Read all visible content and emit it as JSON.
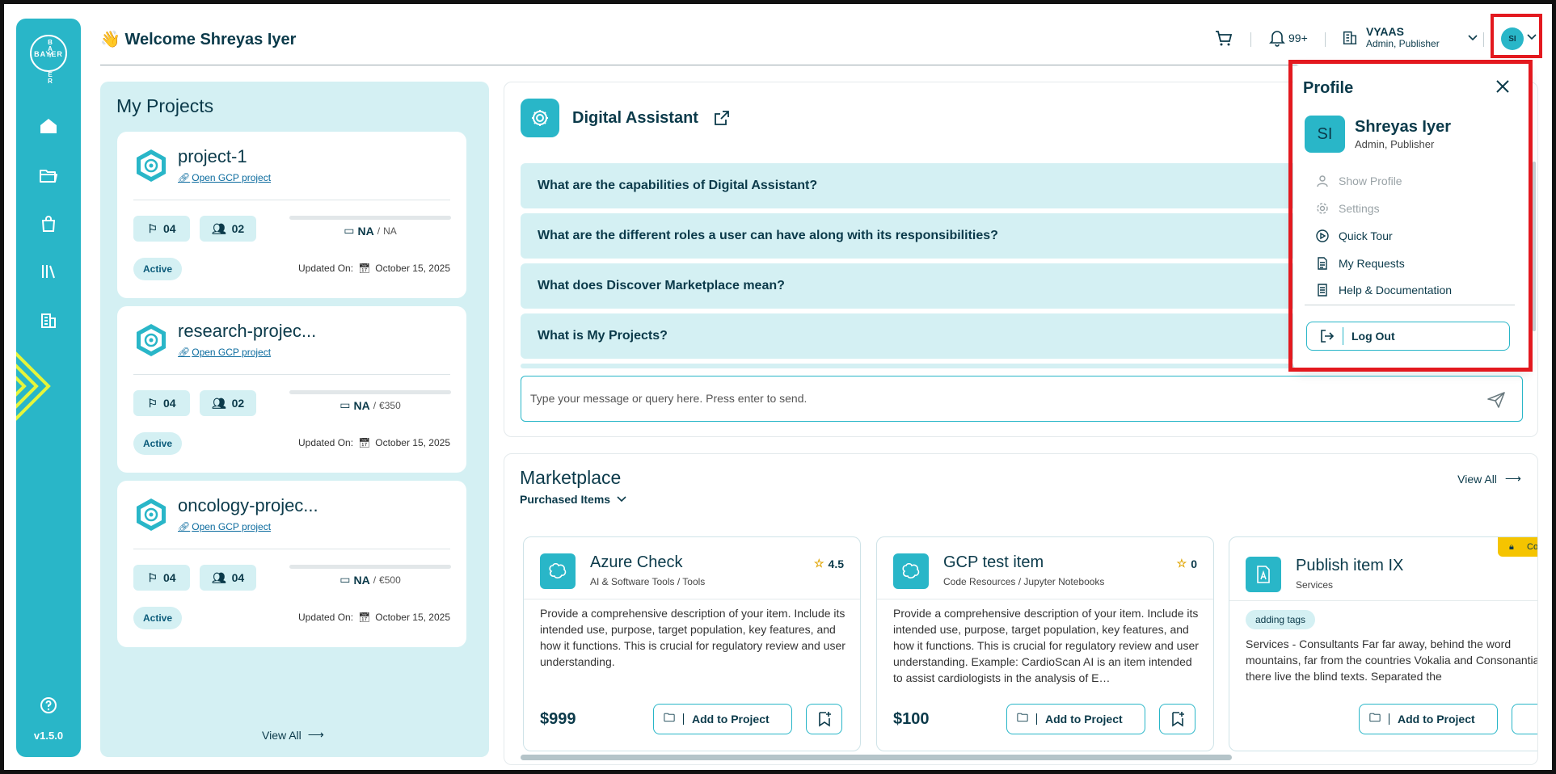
{
  "app": {
    "version": "v1.5.0",
    "logo_text": "BAYER"
  },
  "header": {
    "welcome": "👋 Welcome Shreyas Iyer",
    "notifications": "99+",
    "org_name": "VYAAS",
    "org_role": "Admin, Publisher",
    "avatar_initials": "SI"
  },
  "projects": {
    "title": "My Projects",
    "view_all": "View All",
    "updated_label": "Updated On:",
    "items": [
      {
        "name": "project-1",
        "link": "Open GCP project",
        "flags": "04",
        "members": "02",
        "budget": "NA",
        "budget_of": "NA",
        "status": "Active",
        "updated": "October 15, 2025"
      },
      {
        "name": "research-projec...",
        "link": "Open GCP project",
        "flags": "04",
        "members": "02",
        "budget": "NA",
        "budget_of": "€350",
        "status": "Active",
        "updated": "October 15, 2025"
      },
      {
        "name": "oncology-projec...",
        "link": "Open GCP project",
        "flags": "04",
        "members": "04",
        "budget": "NA",
        "budget_of": "€500",
        "status": "Active",
        "updated": "October 15, 2025"
      }
    ]
  },
  "assistant": {
    "title": "Digital Assistant",
    "questions": [
      "What are the capabilities of Digital Assistant?",
      "What are the different roles a user can have along with its responsibilities?",
      "What does Discover Marketplace mean?",
      "What is My Projects?"
    ],
    "input_placeholder": "Type your message or query here. Press enter to send."
  },
  "marketplace": {
    "title": "Marketplace",
    "filter": "Purchased Items",
    "view_all": "View All",
    "add_label": "Add to Project",
    "items": [
      {
        "name": "Azure Check",
        "category": "AI & Software Tools / Tools",
        "rating": "4.5",
        "description": "Provide a comprehensive description of your item. Include its intended use, purpose, target population, key features, and how it functions. This is crucial for regulatory review and user understanding.",
        "price": "$999"
      },
      {
        "name": "GCP test item",
        "category": "Code Resources / Jupyter Notebooks",
        "rating": "0",
        "description": "Provide a comprehensive description of your item. Include its intended use, purpose, target population, key features, and how it functions. This is crucial for regulatory review and user understanding. Example: CardioScan AI is an item intended to assist cardiologists in the analysis of E…",
        "price": "$100"
      },
      {
        "name": "Publish item IX",
        "category": "Services",
        "tag": "adding tags",
        "badge": "Comp",
        "description": "Services - Consultants Far far away, behind the word mountains, far from the countries Vokalia and Consonantia, there live the blind texts. Separated the"
      }
    ]
  },
  "profile": {
    "title": "Profile",
    "initials": "SI",
    "name": "Shreyas Iyer",
    "role": "Admin, Publisher",
    "menu": [
      "Show Profile",
      "Settings",
      "Quick Tour",
      "My Requests",
      "Help & Documentation"
    ],
    "logout": "Log Out"
  },
  "colors": {
    "accent": "#29b6c8",
    "light": "#d4f0f3",
    "dark": "#0b3a4a",
    "highlight": "#e3191f",
    "warning": "#f5c400"
  }
}
